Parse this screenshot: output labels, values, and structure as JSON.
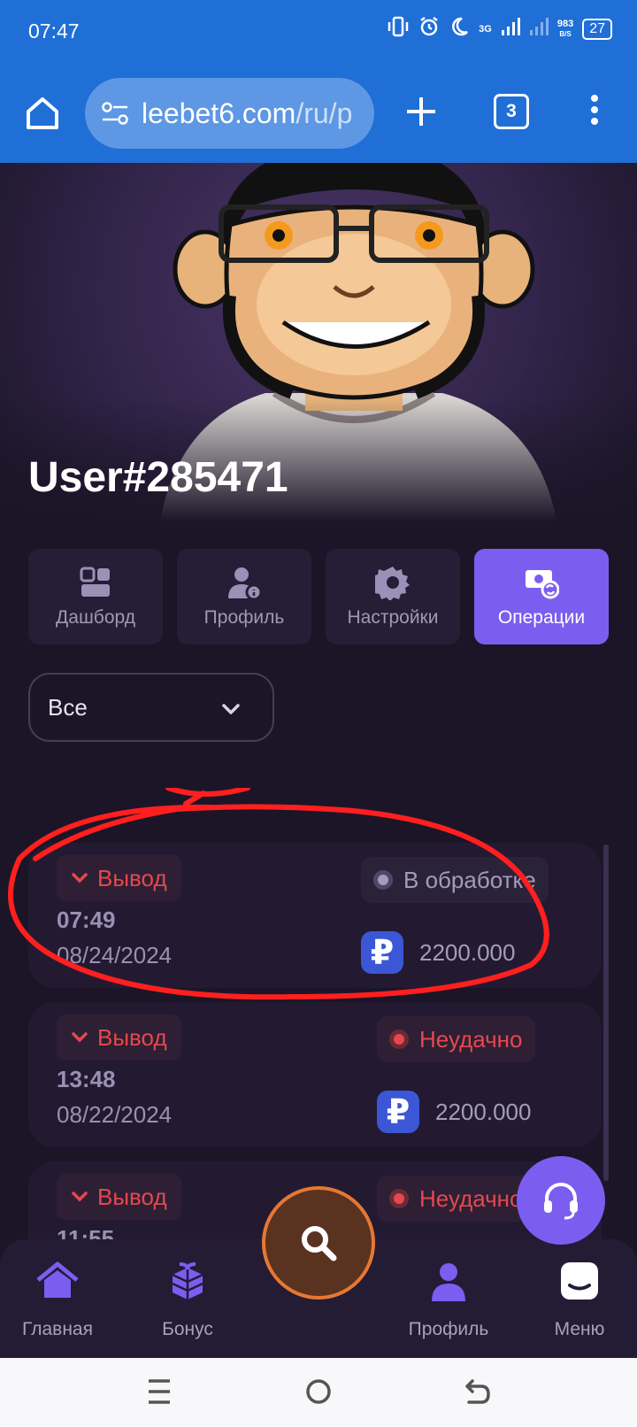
{
  "status_bar": {
    "time": "07:47",
    "net_type": "3G",
    "speed_value": "983",
    "speed_unit": "B/S",
    "battery": "27"
  },
  "browser": {
    "url_main": "leebet6.com",
    "url_path": "/ru/p",
    "tab_count": "3"
  },
  "profile": {
    "username": "User#285471"
  },
  "tabs": [
    {
      "label": "Дашборд",
      "active": false
    },
    {
      "label": "Профиль",
      "active": false
    },
    {
      "label": "Настройки",
      "active": false
    },
    {
      "label": "Операции",
      "active": true
    }
  ],
  "filter": {
    "selected": "Все"
  },
  "transactions": [
    {
      "type": "Вывод",
      "time": "07:49",
      "date": "08/24/2024",
      "status": "В обработке",
      "amount": "2200.000"
    },
    {
      "type": "Вывод",
      "time": "13:48",
      "date": "08/22/2024",
      "status": "Неудачно",
      "amount": "2200.000"
    },
    {
      "type": "Вывод",
      "time": "11:55",
      "date": "",
      "status": "Неудачно",
      "amount": ""
    }
  ],
  "currency_symbol": "₽",
  "bottom_nav": {
    "home": "Главная",
    "bonus": "Бонус",
    "profile": "Профиль",
    "menu": "Меню"
  },
  "colors": {
    "accent": "#7b5ef0",
    "withdraw": "#e5484d",
    "pending": "#a59cbc",
    "failed": "#e5484d",
    "search_ring": "#e67832"
  }
}
